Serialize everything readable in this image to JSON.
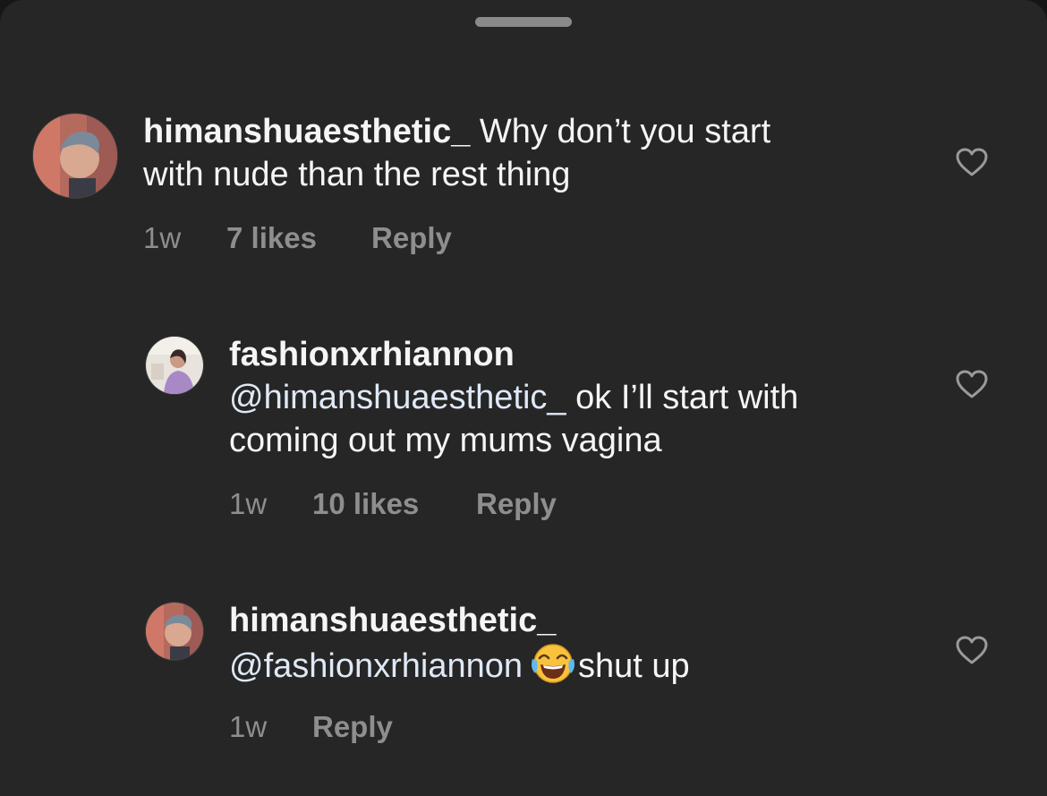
{
  "comments": [
    {
      "username": "himanshuaesthetic_",
      "line1_rest": " Why don’t you start",
      "line2": "with nude than the rest thing",
      "time": "1w",
      "likes": "7 likes",
      "reply": "Reply",
      "avatar_icon": "profile-photo-icon",
      "like_icon": "heart-outline-icon"
    },
    {
      "username": "fashionxrhiannon",
      "mention": "@himanshuaesthetic_",
      "line2_rest": " ok I’ll start with",
      "line3": "coming out my mums vagina",
      "time": "1w",
      "likes": "10 likes",
      "reply": "Reply",
      "avatar_icon": "profile-photo-icon",
      "like_icon": "heart-outline-icon"
    },
    {
      "username": "himanshuaesthetic_",
      "mention": "@fashionxrhiannon",
      "emoji": "face-with-tears-of-joy-emoji",
      "line2_rest": "shut up",
      "time": "1w",
      "reply": "Reply",
      "avatar_icon": "profile-photo-icon",
      "like_icon": "heart-outline-icon"
    }
  ],
  "colors": {
    "background": "#262626",
    "text": "#f5f5f5",
    "secondary_text": "#8e8e8e",
    "mention": "#dfe9f6"
  }
}
